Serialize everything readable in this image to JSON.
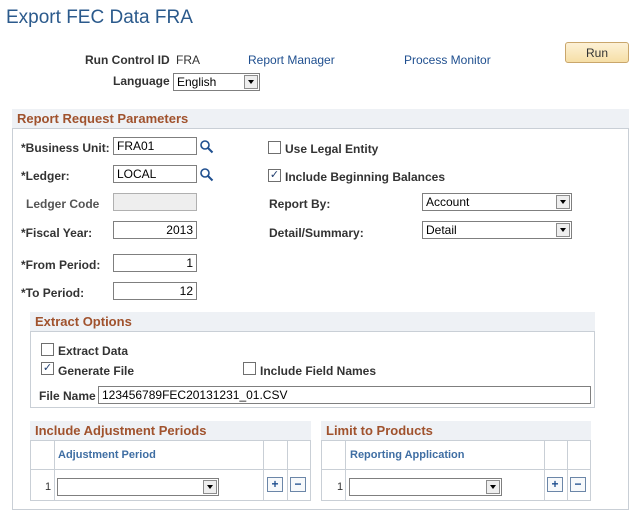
{
  "page": {
    "title": "Export FEC Data FRA"
  },
  "header": {
    "run_control_label": "Run Control ID",
    "run_control_value": "FRA",
    "report_manager_link": "Report Manager",
    "process_monitor_link": "Process Monitor",
    "run_button": "Run",
    "language_label": "Language",
    "language_value": "English"
  },
  "params": {
    "section_title": "Report Request Parameters",
    "business_unit_label": "*Business Unit:",
    "business_unit_value": "FRA01",
    "ledger_label": "*Ledger:",
    "ledger_value": "LOCAL",
    "ledger_code_label": "Ledger Code",
    "ledger_code_value": "",
    "fiscal_year_label": "*Fiscal Year:",
    "fiscal_year_value": "2013",
    "from_period_label": "*From Period:",
    "from_period_value": "1",
    "to_period_label": "*To Period:",
    "to_period_value": "12",
    "use_legal_entity_label": "Use Legal Entity",
    "use_legal_entity_checked": false,
    "include_beginning_label": "Include Beginning Balances",
    "include_beginning_checked": true,
    "report_by_label": "Report By:",
    "report_by_value": "Account",
    "detail_summary_label": "Detail/Summary:",
    "detail_summary_value": "Detail"
  },
  "extract": {
    "section_title": "Extract Options",
    "extract_data_label": "Extract Data",
    "extract_data_checked": false,
    "generate_file_label": "Generate File",
    "generate_file_checked": true,
    "include_field_names_label": "Include Field Names",
    "include_field_names_checked": false,
    "file_name_label": "File Name",
    "file_name_value": "123456789FEC20131231_01.CSV"
  },
  "adjustment": {
    "section_title": "Include Adjustment Periods",
    "column_header": "Adjustment Period",
    "row_number": "1",
    "value": ""
  },
  "products": {
    "section_title": "Limit to Products",
    "column_header": "Reporting Application",
    "row_number": "1",
    "value": ""
  },
  "icons": {
    "lookup": "magnifier-icon",
    "add_row": "plus-icon",
    "delete_row": "minus-icon",
    "dropdown": "chevron-down-icon",
    "checkmark": "✓"
  },
  "colors": {
    "title": "#2b5a8c",
    "section_title": "#a0522d",
    "grid_header": "#3f6ea3",
    "run_button": "#f6dfa6",
    "link": "#1f4f8f"
  }
}
